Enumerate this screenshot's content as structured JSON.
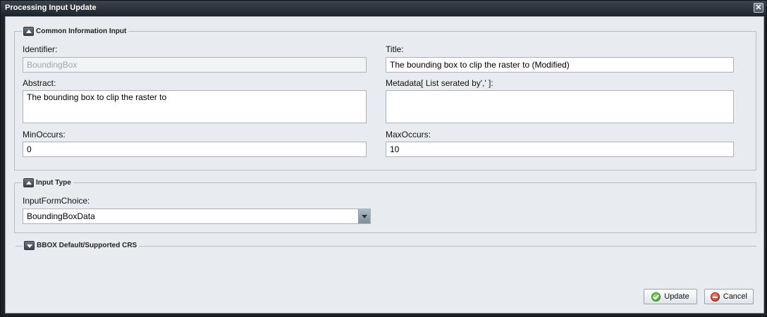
{
  "window": {
    "title": "Processing Input Update",
    "close_glyph": "✕"
  },
  "common": {
    "legend": "Common Information Input",
    "identifier": {
      "label": "Identifier:",
      "value": "BoundingBox"
    },
    "title": {
      "label": "Title:",
      "value": "The bounding box to clip the raster to (Modified)"
    },
    "abstract": {
      "label": "Abstract:",
      "value": "The bounding box to clip the raster to"
    },
    "metadata": {
      "label": "Metadata[ List serated by',' ]:",
      "value": ""
    },
    "min_occurs": {
      "label": "MinOccurs:",
      "value": "0"
    },
    "max_occurs": {
      "label": "MaxOccurs:",
      "value": "10"
    }
  },
  "input_type": {
    "legend": "Input Type",
    "choice": {
      "label": "InputFormChoice:",
      "value": "BoundingBoxData"
    }
  },
  "bbox": {
    "legend": "BBOX Default/Supported CRS"
  },
  "buttons": {
    "update": "Update",
    "cancel": "Cancel"
  },
  "icons": {
    "collapse": "collapse-toggle-icon",
    "expand": "expand-toggle-icon",
    "update": "check-icon",
    "cancel": "cancel-icon",
    "dropdown": "chevron-down-icon",
    "close": "close-icon"
  }
}
